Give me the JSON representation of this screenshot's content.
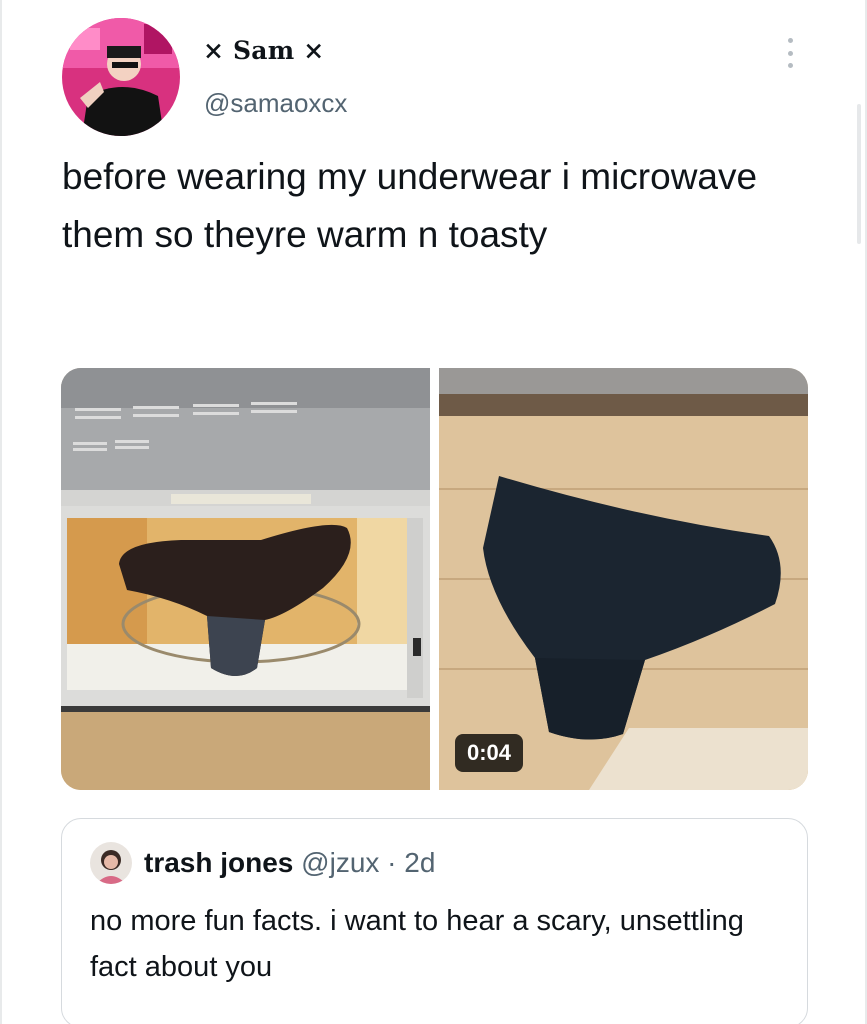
{
  "tweet": {
    "display_name": "× Sam ×",
    "handle": "@samaoxcx",
    "text": "before wearing my underwear i microwave them so theyre warm n toasty",
    "video_duration": "0:04"
  },
  "quoted_tweet": {
    "display_name": "trash jones",
    "handle": "@jzux",
    "separator": " · ",
    "age": "2d",
    "text": "no more fun facts. i want to hear a scary, unsettling fact about you"
  },
  "icons": {
    "more": "more-options-icon"
  }
}
